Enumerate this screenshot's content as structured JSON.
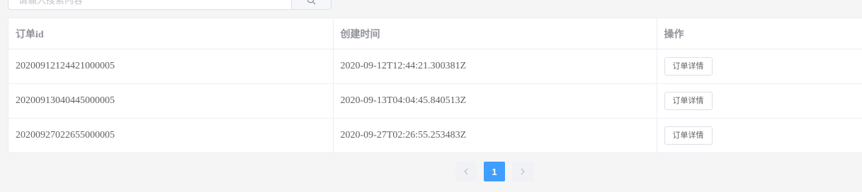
{
  "search": {
    "placeholder": "请输入搜索内容",
    "button_icon": "search-icon"
  },
  "table": {
    "headers": [
      "订单id",
      "创建时间",
      "操作"
    ],
    "rows": [
      {
        "order_id": "20200912124421000005",
        "created_at": "2020-09-12T12:44:21.300381Z",
        "action_label": "订单详情"
      },
      {
        "order_id": "20200913040445000005",
        "created_at": "2020-09-13T04:04:45.840513Z",
        "action_label": "订单详情"
      },
      {
        "order_id": "20200927022655000005",
        "created_at": "2020-09-27T02:26:55.253483Z",
        "action_label": "订单详情"
      }
    ]
  },
  "pagination": {
    "prev_icon": "chevron-left-icon",
    "current_page": "1",
    "next_icon": "chevron-right-icon"
  },
  "colors": {
    "accent": "#409eff",
    "border": "#ebeef5",
    "background": "#f5f5f6"
  }
}
